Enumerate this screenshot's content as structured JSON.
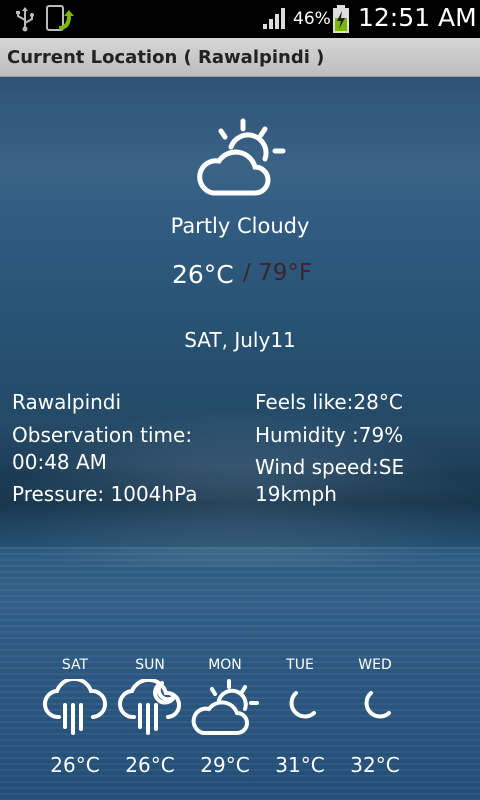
{
  "status_bar": {
    "battery_percent": "46%",
    "time": "12:51 AM",
    "icons": [
      "usb-icon",
      "app-download-icon",
      "signal-icon",
      "battery-charging-icon"
    ]
  },
  "title_bar": {
    "title": "Current Location ( Rawalpindi )"
  },
  "current": {
    "condition": "Partly Cloudy",
    "icon": "partly-cloudy-icon",
    "temp_c": "26°C",
    "temp_f": "/ 79°F",
    "date": "SAT, July11"
  },
  "details": {
    "location": "Rawalpindi",
    "observation_label": "Observation time:",
    "observation_time": "00:48 AM",
    "pressure": "Pressure: 1004hPa",
    "feels_like": "Feels like:28°C",
    "humidity": "Humidity :79%",
    "wind_label": "Wind speed:SE",
    "wind_value": "19kmph"
  },
  "forecast": [
    {
      "day": "SAT",
      "temp": "26°C",
      "icon": "rain-icon"
    },
    {
      "day": "SUN",
      "temp": "26°C",
      "icon": "night-rain-icon"
    },
    {
      "day": "MON",
      "temp": "29°C",
      "icon": "partly-cloudy-icon"
    },
    {
      "day": "TUE",
      "temp": "31°C",
      "icon": "moon-icon"
    },
    {
      "day": "WED",
      "temp": "32°C",
      "icon": "moon-icon"
    }
  ],
  "colors": {
    "title_bar": "#c9c9c9",
    "fahrenheit_text": "#3b2430",
    "background": "#2d5a80"
  }
}
